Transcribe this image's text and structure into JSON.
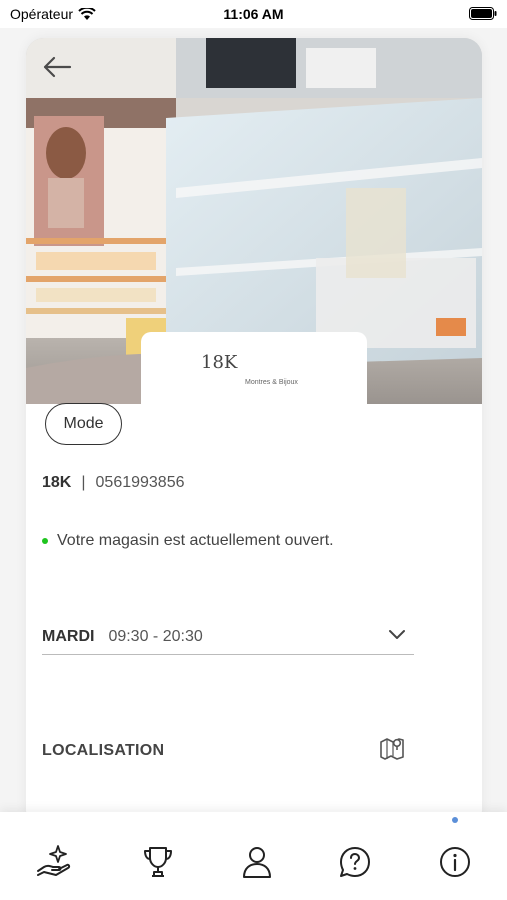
{
  "status_bar": {
    "carrier": "Opérateur",
    "time": "11:06 AM"
  },
  "store": {
    "category": "Mode",
    "name": "18K",
    "separator": "|",
    "phone": "0561993856",
    "open_status": "Votre magasin est actuellement ouvert.",
    "status_color": "#1ec41e",
    "logo_text": "18K",
    "logo_subtext": "Montres & Bijoux"
  },
  "hours": {
    "day": "MARDI",
    "time": "09:30 - 20:30"
  },
  "location": {
    "label": "LOCALISATION"
  },
  "nav": {
    "items": [
      "rewards-hand-icon",
      "trophy-icon",
      "profile-icon",
      "help-icon",
      "info-icon"
    ],
    "active": "info-icon",
    "active_dot_color": "#5b8fd8"
  }
}
